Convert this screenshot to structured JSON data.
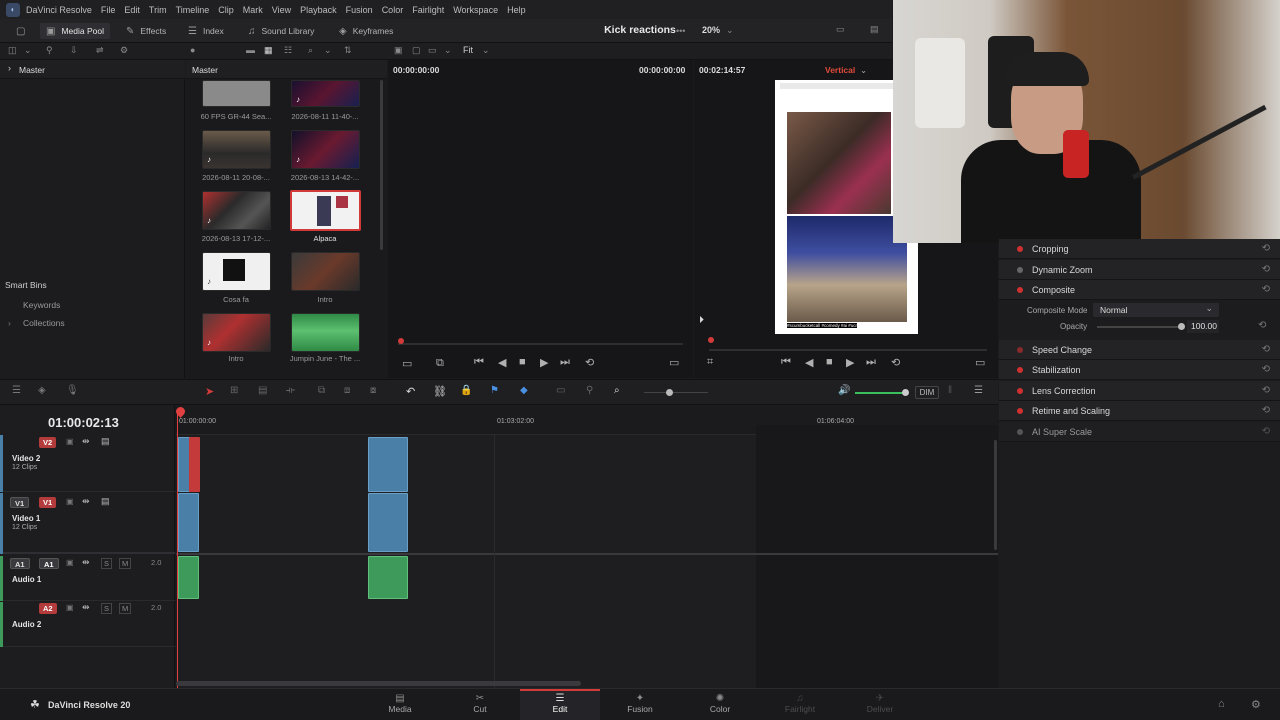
{
  "app": {
    "name": "DaVinci Resolve",
    "brand_footer": "DaVinci Resolve 20",
    "accent": "#d33a3a"
  },
  "menu": [
    "DaVinci Resolve",
    "File",
    "Edit",
    "Trim",
    "Timeline",
    "Clip",
    "Mark",
    "View",
    "Playback",
    "Fusion",
    "Color",
    "Fairlight",
    "Workspace",
    "Help"
  ],
  "toolbar": {
    "media_pool": "Media Pool",
    "effects": "Effects",
    "index": "Index",
    "sound_library": "Sound Library",
    "keyframes": "Keyframes",
    "project_title": "Kick reactions",
    "fit": "Fit",
    "zoom": "20%"
  },
  "bins": {
    "master": "Master",
    "smart_bins": "Smart Bins",
    "keywords": "Keywords",
    "collections": "Collections"
  },
  "pool": {
    "header": "Master",
    "clips": [
      {
        "caption": "60 FPS GR-44 Sea..."
      },
      {
        "caption": "2026-08-11 11-40-..."
      },
      {
        "caption": "2026-08-11 20-08-..."
      },
      {
        "caption": "2026-08-13 14-42-..."
      },
      {
        "caption": "2026-08-13 17-12-..."
      },
      {
        "caption": "Alpaca",
        "selected": true
      },
      {
        "caption": "Cosa fa"
      },
      {
        "caption": "Intro"
      },
      {
        "caption": "Intro"
      },
      {
        "caption": "Jumpin June - The ..."
      }
    ]
  },
  "viewers": {
    "source_tc_in": "00:00:00:00",
    "source_tc_out": "00:00:00:00",
    "timeline_duration": "00:02:14:57",
    "timeline_label": "Vertical",
    "overlay_text": "#scumbucketcall #comedy #ai #ucr"
  },
  "inspector": {
    "items": [
      {
        "label": "Cropping",
        "on": true
      },
      {
        "label": "Dynamic Zoom",
        "on": false
      },
      {
        "label": "Composite",
        "on": true
      },
      {
        "label": "Speed Change",
        "on": true
      },
      {
        "label": "Stabilization",
        "on": true
      },
      {
        "label": "Lens Correction",
        "on": true
      },
      {
        "label": "Retime and Scaling",
        "on": true
      },
      {
        "label": "AI Super Scale",
        "on": false
      }
    ],
    "composite_mode_label": "Composite Mode",
    "composite_mode_value": "Normal",
    "opacity_label": "Opacity",
    "opacity_value": "100.00"
  },
  "timeline": {
    "timecode": "01:00:02:13",
    "dim": "DIM",
    "ruler": [
      "01:00:00:00",
      "01:03:02:00",
      "01:06:04:00"
    ],
    "tracks": [
      {
        "id": "V2",
        "name": "Video 2",
        "sub": "12 Clips"
      },
      {
        "id": "V1",
        "name": "Video 1",
        "sub": "12 Clips"
      },
      {
        "id": "A1",
        "name": "Audio 1",
        "level": "2.0"
      },
      {
        "id": "A2",
        "name": "Audio 2",
        "level": "2.0"
      }
    ]
  },
  "pages": [
    {
      "label": "Media"
    },
    {
      "label": "Cut"
    },
    {
      "label": "Edit",
      "active": true
    },
    {
      "label": "Fusion"
    },
    {
      "label": "Color"
    },
    {
      "label": "Fairlight",
      "dim": true
    },
    {
      "label": "Deliver",
      "dim": true
    }
  ]
}
